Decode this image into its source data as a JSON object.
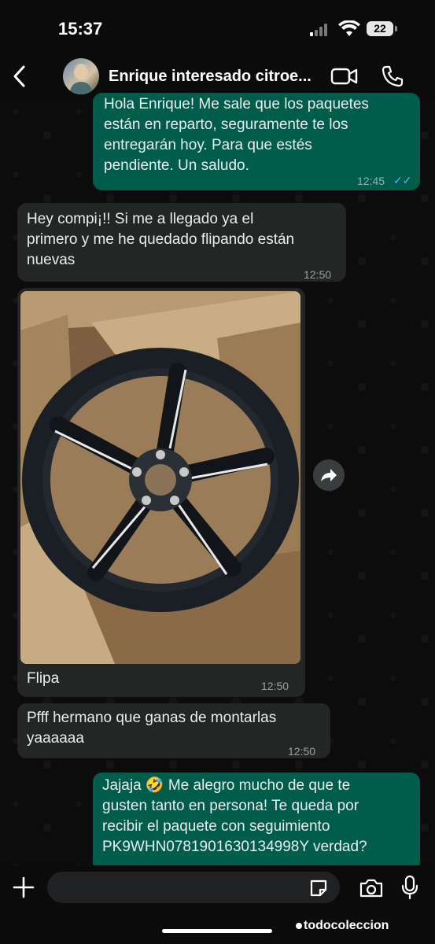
{
  "status_bar": {
    "time": "15:37",
    "battery": "22"
  },
  "header": {
    "contact_name": "Enrique interesado citroe..."
  },
  "messages": [
    {
      "direction": "out",
      "lines": [
        "Hola Enrique! Me sale que los paquetes",
        "están en reparto, seguramente te los",
        "entregarán hoy. Para que estés",
        "pendiente. Un saludo."
      ],
      "time": "12:45",
      "ticks": "✓✓"
    },
    {
      "direction": "in",
      "lines": [
        "Hey compi¡!! Si me a llegado ya el",
        "primero y me he quedado flipando están",
        "nuevas"
      ],
      "time": "12:50"
    },
    {
      "direction": "in",
      "type": "image",
      "caption": "Flipa",
      "time": "12:50"
    },
    {
      "direction": "in",
      "lines": [
        "Pfff hermano que ganas de montarlas",
        "yaaaaaa"
      ],
      "time": "12:50"
    },
    {
      "direction": "out",
      "lines": [
        "Jajaja 🤣 Me alegro mucho de que te",
        "gusten tanto en persona! Te queda por",
        "recibir el paquete con seguimiento",
        "PK9WHN0781901630134998Y verdad?"
      ]
    }
  ],
  "input": {
    "placeholder": ""
  },
  "watermark": "todocoleccion",
  "colors": {
    "outgoing_bubble": "#005c4b",
    "incoming_bubble": "#242626",
    "read_ticks": "#53bdeb"
  }
}
